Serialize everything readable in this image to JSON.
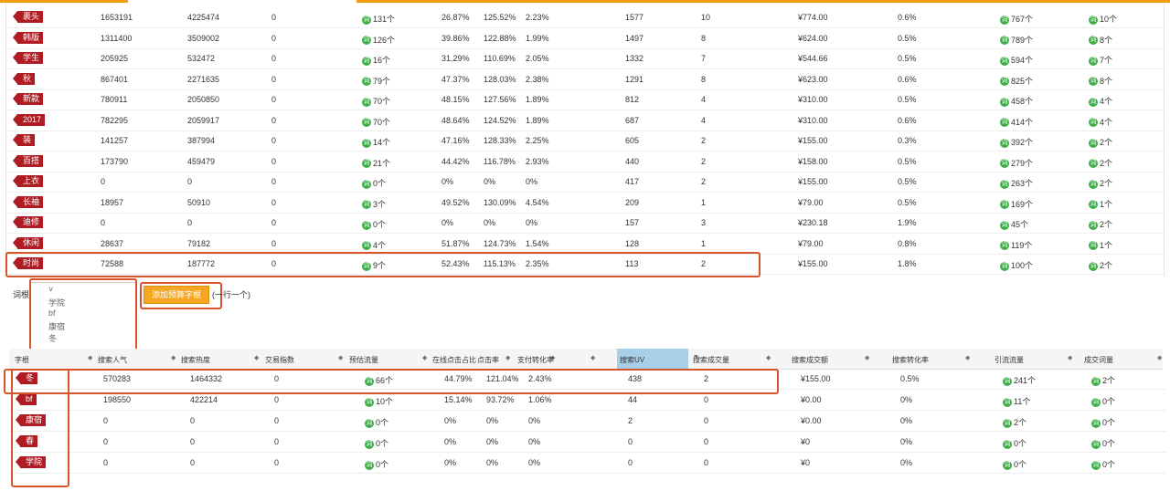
{
  "upper_rows": [
    {
      "kw": "裹头",
      "c1": "1653191",
      "c2": "4225474",
      "c3": "0",
      "c4": "131个",
      "c5": "26.87%",
      "c6": "125.52%",
      "c7": "2.23%",
      "c8": "1577",
      "c9": "10",
      "c10": "¥774.00",
      "c11": "0.6%",
      "c12": "767个",
      "c13": "10个"
    },
    {
      "kw": "韩版",
      "c1": "1311400",
      "c2": "3509002",
      "c3": "0",
      "c4": "126个",
      "c5": "39.86%",
      "c6": "122.88%",
      "c7": "1.99%",
      "c8": "1497",
      "c9": "8",
      "c10": "¥624.00",
      "c11": "0.5%",
      "c12": "789个",
      "c13": "8个"
    },
    {
      "kw": "学生",
      "c1": "205925",
      "c2": "532472",
      "c3": "0",
      "c4": "16个",
      "c5": "31.29%",
      "c6": "110.69%",
      "c7": "2.05%",
      "c8": "1332",
      "c9": "7",
      "c10": "¥544.66",
      "c11": "0.5%",
      "c12": "594个",
      "c13": "7个"
    },
    {
      "kw": "秋",
      "c1": "867401",
      "c2": "2271635",
      "c3": "0",
      "c4": "79个",
      "c5": "47.37%",
      "c6": "128.03%",
      "c7": "2.38%",
      "c8": "1291",
      "c9": "8",
      "c10": "¥623.00",
      "c11": "0.6%",
      "c12": "825个",
      "c13": "8个"
    },
    {
      "kw": "新款",
      "c1": "780911",
      "c2": "2050850",
      "c3": "0",
      "c4": "70个",
      "c5": "48.15%",
      "c6": "127.56%",
      "c7": "1.89%",
      "c8": "812",
      "c9": "4",
      "c10": "¥310.00",
      "c11": "0.5%",
      "c12": "458个",
      "c13": "4个"
    },
    {
      "kw": "2017",
      "c1": "782295",
      "c2": "2059917",
      "c3": "0",
      "c4": "70个",
      "c5": "48.64%",
      "c6": "124.52%",
      "c7": "1.89%",
      "c8": "687",
      "c9": "4",
      "c10": "¥310.00",
      "c11": "0.6%",
      "c12": "414个",
      "c13": "4个"
    },
    {
      "kw": "装",
      "c1": "141257",
      "c2": "387994",
      "c3": "0",
      "c4": "14个",
      "c5": "47.16%",
      "c6": "128.33%",
      "c7": "2.25%",
      "c8": "605",
      "c9": "2",
      "c10": "¥155.00",
      "c11": "0.3%",
      "c12": "392个",
      "c13": "2个"
    },
    {
      "kw": "百搭",
      "c1": "173790",
      "c2": "459479",
      "c3": "0",
      "c4": "21个",
      "c5": "44.42%",
      "c6": "116.78%",
      "c7": "2.93%",
      "c8": "440",
      "c9": "2",
      "c10": "¥158.00",
      "c11": "0.5%",
      "c12": "279个",
      "c13": "2个"
    },
    {
      "kw": "上衣",
      "c1": "0",
      "c2": "0",
      "c3": "0",
      "c4": "0个",
      "c5": "0%",
      "c6": "0%",
      "c7": "0%",
      "c8": "417",
      "c9": "2",
      "c10": "¥155.00",
      "c11": "0.5%",
      "c12": "263个",
      "c13": "2个"
    },
    {
      "kw": "长袖",
      "c1": "18957",
      "c2": "50910",
      "c3": "0",
      "c4": "3个",
      "c5": "49.52%",
      "c6": "130.09%",
      "c7": "4.54%",
      "c8": "209",
      "c9": "1",
      "c10": "¥79.00",
      "c11": "0.5%",
      "c12": "169个",
      "c13": "1个"
    },
    {
      "kw": "迪修",
      "c1": "0",
      "c2": "0",
      "c3": "0",
      "c4": "0个",
      "c5": "0%",
      "c6": "0%",
      "c7": "0%",
      "c8": "157",
      "c9": "3",
      "c10": "¥230.18",
      "c11": "1.9%",
      "c12": "45个",
      "c13": "2个"
    },
    {
      "kw": "休闲",
      "c1": "28637",
      "c2": "79182",
      "c3": "0",
      "c4": "4个",
      "c5": "51.87%",
      "c6": "124.73%",
      "c7": "1.54%",
      "c8": "128",
      "c9": "1",
      "c10": "¥79.00",
      "c11": "0.8%",
      "c12": "119个",
      "c13": "1个"
    },
    {
      "kw": "时尚",
      "c1": "72588",
      "c2": "187772",
      "c3": "0",
      "c4": "9个",
      "c5": "52.43%",
      "c6": "115.13%",
      "c7": "2.35%",
      "c8": "113",
      "c9": "2",
      "c10": "¥155.00",
      "c11": "1.8%",
      "c12": "100个",
      "c13": "2个"
    }
  ],
  "controls": {
    "label": "词根预算",
    "textarea_lines": [
      "学院",
      "bf",
      "康宿",
      "冬"
    ],
    "add_button": "添加预算字根",
    "hint": "(一行一个)"
  },
  "lower_header": [
    "字根",
    "搜索人气",
    "搜索热度",
    "交易指数",
    "预估流量",
    "在线点击占比",
    "点击率",
    "支付转化率",
    "搜索UV",
    "搜索成交量",
    "搜索成交额",
    "搜索转化率",
    "引流流量",
    "成交词量"
  ],
  "lower_rows": [
    {
      "kw": "冬",
      "c1": "570283",
      "c2": "1464332",
      "c3": "0",
      "c4": "66个",
      "c5": "44.79%",
      "c6": "121.04%",
      "c7": "2.43%",
      "c8": "438",
      "c9": "2",
      "c10": "¥155.00",
      "c11": "0.5%",
      "c12": "241个",
      "c13": "2个"
    },
    {
      "kw": "bf",
      "c1": "198550",
      "c2": "422214",
      "c3": "0",
      "c4": "10个",
      "c5": "15.14%",
      "c6": "93.72%",
      "c7": "1.06%",
      "c8": "44",
      "c9": "0",
      "c10": "¥0.00",
      "c11": "0%",
      "c12": "11个",
      "c13": "0个"
    },
    {
      "kw": "康宿",
      "c1": "0",
      "c2": "0",
      "c3": "0",
      "c4": "0个",
      "c5": "0%",
      "c6": "0%",
      "c7": "0%",
      "c8": "2",
      "c9": "0",
      "c10": "¥0.00",
      "c11": "0%",
      "c12": "2个",
      "c13": "0个"
    },
    {
      "kw": "春",
      "c1": "0",
      "c2": "0",
      "c3": "0",
      "c4": "0个",
      "c5": "0%",
      "c6": "0%",
      "c7": "0%",
      "c8": "0",
      "c9": "0",
      "c10": "¥0",
      "c11": "0%",
      "c12": "0个",
      "c13": "0个"
    },
    {
      "kw": "学院",
      "c1": "0",
      "c2": "0",
      "c3": "0",
      "c4": "0个",
      "c5": "0%",
      "c6": "0%",
      "c7": "0%",
      "c8": "0",
      "c9": "0",
      "c10": "¥0",
      "c11": "0%",
      "c12": "0个",
      "c13": "0个"
    }
  ],
  "icon_glyph": "词",
  "colors": {
    "tag_red": "#b01c24",
    "accent_orange": "#f5a623",
    "highlight_box": "#d9532c",
    "icon_green": "#3fae49",
    "sorted_header": "#a8cfe8"
  }
}
